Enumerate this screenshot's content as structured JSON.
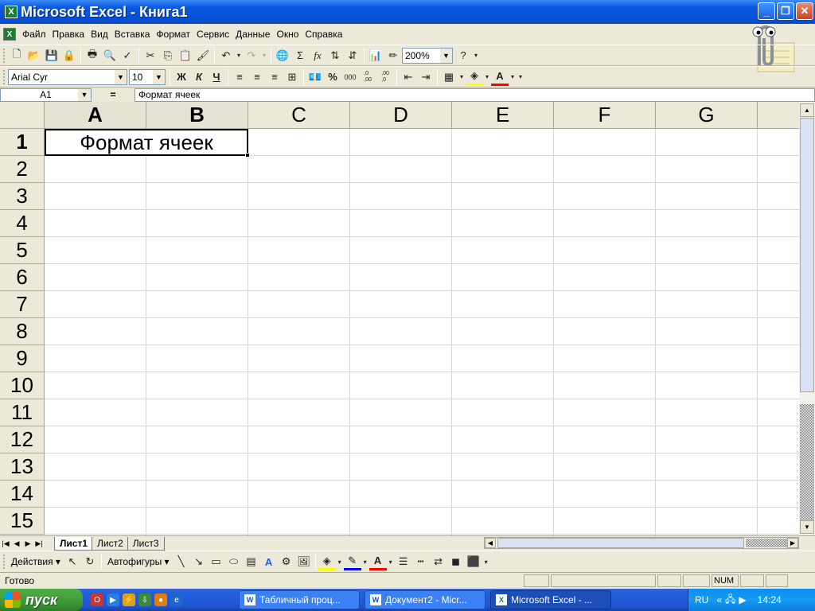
{
  "window": {
    "title": "Microsoft Excel - Книга1",
    "app_icon": "X"
  },
  "menubar": {
    "items": [
      "Файл",
      "Правка",
      "Вид",
      "Вставка",
      "Формат",
      "Сервис",
      "Данные",
      "Окно",
      "Справка"
    ]
  },
  "toolbar_standard": {
    "zoom": "200%"
  },
  "toolbar_format": {
    "font": "Arial Cyr",
    "size": "10",
    "bold": "Ж",
    "italic": "К",
    "underline": "Ч",
    "percent": "%",
    "thousands": "000",
    "inc_decimal": ",0\n,00",
    "dec_decimal": ",00\n,0"
  },
  "formula_bar": {
    "name_box": "A1",
    "equals": "=",
    "content": "Формат ячеек"
  },
  "grid": {
    "columns": [
      "A",
      "B",
      "C",
      "D",
      "E",
      "F",
      "G"
    ],
    "rows": [
      "1",
      "2",
      "3",
      "4",
      "5",
      "6",
      "7",
      "8",
      "9",
      "10",
      "11",
      "12",
      "13",
      "14",
      "15"
    ],
    "cell_A1": "Формат ячеек"
  },
  "sheet_tabs": [
    "Лист1",
    "Лист2",
    "Лист3"
  ],
  "drawing_toolbar": {
    "actions": "Действия",
    "autoshapes": "Автофигуры"
  },
  "status": {
    "text": "Готово",
    "num": "NUM"
  },
  "taskbar": {
    "start": "пуск",
    "tasks": [
      "Табличный проц...",
      "Документ2 - Micr...",
      "Microsoft Excel - ..."
    ],
    "lang": "RU",
    "time": "14:24"
  }
}
